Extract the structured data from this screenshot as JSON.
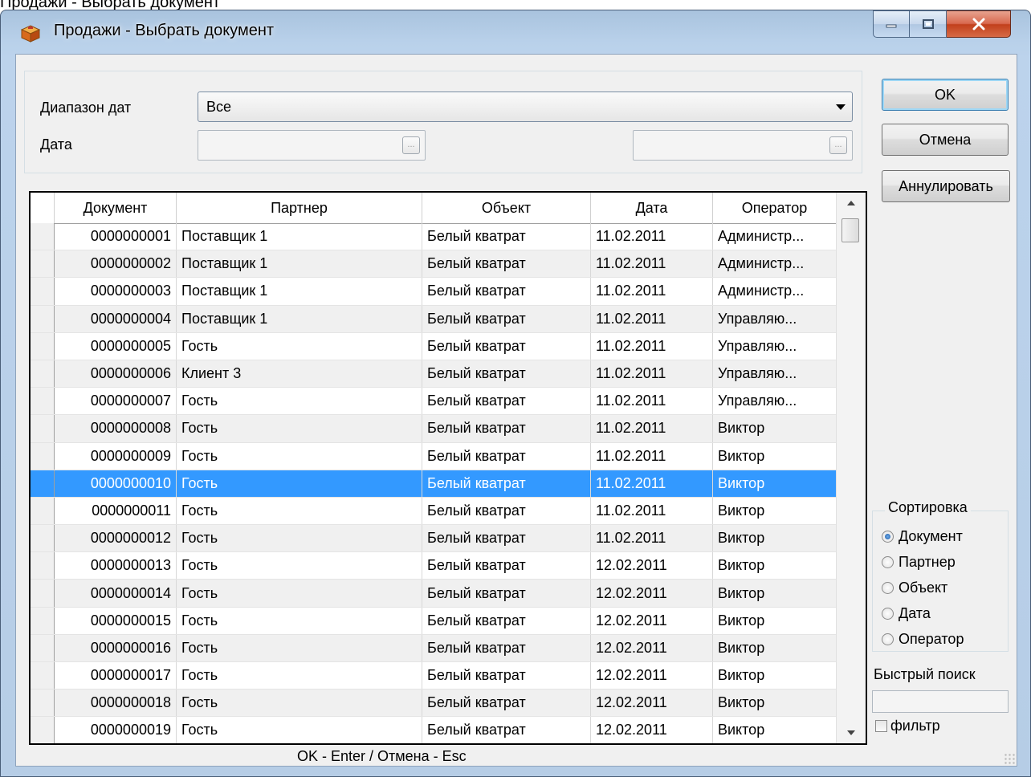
{
  "window": {
    "title": "Продажи - Выбрать документ",
    "cropped_caption": "Продажи - Выбрать документ"
  },
  "filters": {
    "date_range_label": "Диапазон дат",
    "date_range_value": "Все",
    "date_label": "Дата",
    "date_from_value": "",
    "date_to_value": "",
    "picker_glyph": "..."
  },
  "buttons": {
    "ok": "OK",
    "cancel": "Отмена",
    "annul": "Аннулировать"
  },
  "table": {
    "headers": [
      "Документ",
      "Партнер",
      "Объект",
      "Дата",
      "Оператор"
    ],
    "selected_row": 9,
    "rows": [
      [
        "0000000001",
        "Поставщик 1",
        "Белый кватрат",
        "11.02.2011",
        "Администр..."
      ],
      [
        "0000000002",
        "Поставщик 1",
        "Белый кватрат",
        "11.02.2011",
        "Администр..."
      ],
      [
        "0000000003",
        "Поставщик 1",
        "Белый кватрат",
        "11.02.2011",
        "Администр..."
      ],
      [
        "0000000004",
        "Поставщик 1",
        "Белый кватрат",
        "11.02.2011",
        "Управляю..."
      ],
      [
        "0000000005",
        "Гость",
        "Белый кватрат",
        "11.02.2011",
        "Управляю..."
      ],
      [
        "0000000006",
        "Клиент 3",
        "Белый кватрат",
        "11.02.2011",
        "Управляю..."
      ],
      [
        "0000000007",
        "Гость",
        "Белый кватрат",
        "11.02.2011",
        "Управляю..."
      ],
      [
        "0000000008",
        "Гость",
        "Белый кватрат",
        "11.02.2011",
        "Виктор"
      ],
      [
        "0000000009",
        "Гость",
        "Белый кватрат",
        "11.02.2011",
        "Виктор"
      ],
      [
        "0000000010",
        "Гость",
        "Белый кватрат",
        "11.02.2011",
        "Виктор"
      ],
      [
        "0000000011",
        "Гость",
        "Белый кватрат",
        "11.02.2011",
        "Виктор"
      ],
      [
        "0000000012",
        "Гость",
        "Белый кватрат",
        "11.02.2011",
        "Виктор"
      ],
      [
        "0000000013",
        "Гость",
        "Белый кватрат",
        "12.02.2011",
        "Виктор"
      ],
      [
        "0000000014",
        "Гость",
        "Белый кватрат",
        "12.02.2011",
        "Виктор"
      ],
      [
        "0000000015",
        "Гость",
        "Белый кватрат",
        "12.02.2011",
        "Виктор"
      ],
      [
        "0000000016",
        "Гость",
        "Белый кватрат",
        "12.02.2011",
        "Виктор"
      ],
      [
        "0000000017",
        "Гость",
        "Белый кватрат",
        "12.02.2011",
        "Виктор"
      ],
      [
        "0000000018",
        "Гость",
        "Белый кватрат",
        "12.02.2011",
        "Виктор"
      ],
      [
        "0000000019",
        "Гость",
        "Белый кватрат",
        "12.02.2011",
        "Виктор"
      ]
    ]
  },
  "sort": {
    "title": "Сортировка",
    "options": [
      "Документ",
      "Партнер",
      "Объект",
      "Дата",
      "Оператор"
    ],
    "selected": "Документ"
  },
  "quick_search": {
    "label": "Быстрый поиск",
    "value": "",
    "filter_label": "фильтр",
    "filter_checked": false
  },
  "status_hint": "OK - Enter / Отмена - Esc",
  "colors": {
    "selection": "#3399ff",
    "close_button": "#c2401c",
    "frame": "#b9d1ea"
  }
}
